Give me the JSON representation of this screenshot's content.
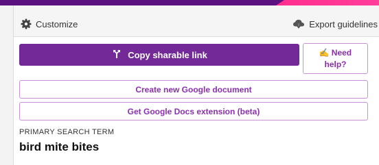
{
  "toolbar": {
    "customize_label": "Customize",
    "customize_icon": "gear-icon",
    "export_label": "Export guidelines",
    "export_icon": "cloud-download-icon"
  },
  "actions": {
    "copy_link_label": "Copy sharable link",
    "copy_link_icon": "branch-link-icon",
    "need_help_emoji": "✍️",
    "need_help_line1": "Need",
    "need_help_line2": "help?",
    "create_doc_label": "Create new Google document",
    "extension_label": "Get Google Docs extension (beta)"
  },
  "search": {
    "label": "PRIMARY SEARCH TERM",
    "value": "bird mite bites"
  },
  "colors": {
    "brand_purple": "#732a98",
    "top_bar": "#5b1280",
    "accent_pink": "#ff2e8e",
    "outline": "#c98fd9",
    "link_text": "#8b2fb0"
  }
}
